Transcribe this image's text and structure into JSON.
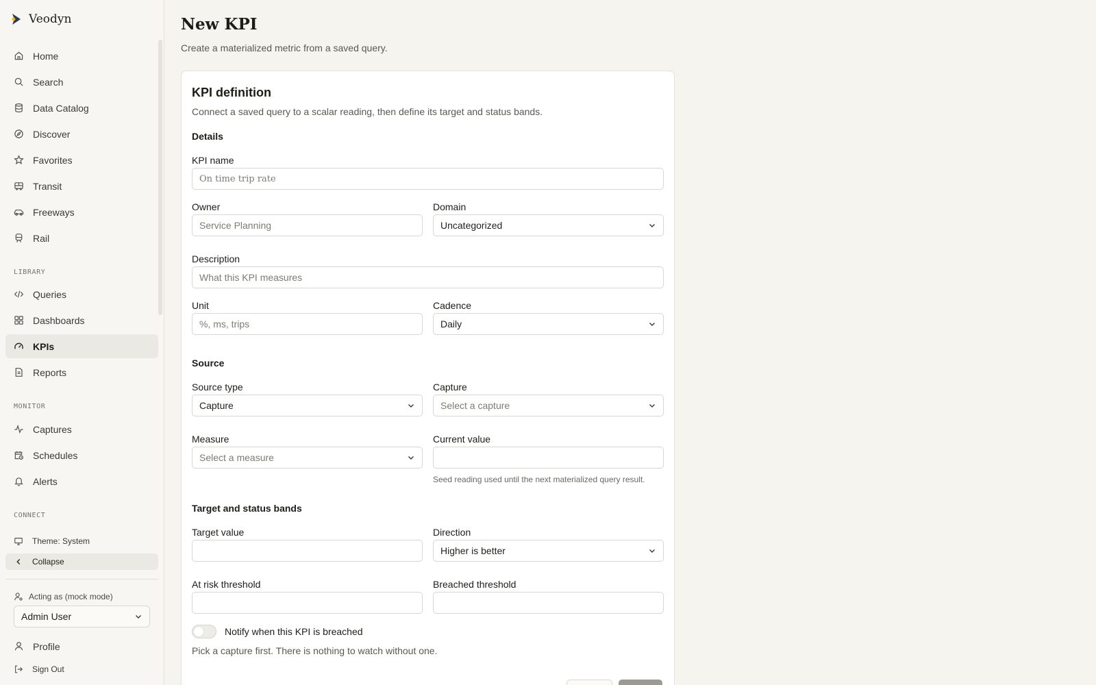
{
  "app": {
    "name": "Veodyn"
  },
  "sidebar": {
    "nav": [
      {
        "label": "Home",
        "icon": "home-icon"
      },
      {
        "label": "Search",
        "icon": "search-icon"
      },
      {
        "label": "Data Catalog",
        "icon": "database-icon"
      },
      {
        "label": "Discover",
        "icon": "compass-icon"
      },
      {
        "label": "Favorites",
        "icon": "star-icon"
      },
      {
        "label": "Transit",
        "icon": "bus-icon"
      },
      {
        "label": "Freeways",
        "icon": "car-icon"
      },
      {
        "label": "Rail",
        "icon": "train-icon"
      }
    ],
    "library_label": "LIBRARY",
    "library": [
      {
        "label": "Queries",
        "icon": "code-icon"
      },
      {
        "label": "Dashboards",
        "icon": "dashboard-icon"
      },
      {
        "label": "KPIs",
        "icon": "gauge-icon",
        "active": true
      },
      {
        "label": "Reports",
        "icon": "report-icon"
      }
    ],
    "monitor_label": "MONITOR",
    "monitor": [
      {
        "label": "Captures",
        "icon": "activity-icon"
      },
      {
        "label": "Schedules",
        "icon": "calendar-clock-icon"
      },
      {
        "label": "Alerts",
        "icon": "bell-icon"
      }
    ],
    "connect_label": "CONNECT",
    "theme_label": "Theme: System",
    "collapse_label": "Collapse",
    "acting_label": "Acting as (mock mode)",
    "acting_user": "Admin User",
    "profile_label": "Profile",
    "signout_label": "Sign Out"
  },
  "page": {
    "title": "New KPI",
    "subtitle": "Create a materialized metric from a saved query."
  },
  "card": {
    "title": "KPI definition",
    "subtitle": "Connect a saved query to a scalar reading, then define its target and status bands.",
    "details_title": "Details",
    "kpi_name": {
      "label": "KPI name",
      "placeholder": "On time trip rate"
    },
    "owner": {
      "label": "Owner",
      "placeholder": "Service Planning"
    },
    "domain": {
      "label": "Domain",
      "value": "Uncategorized"
    },
    "description": {
      "label": "Description",
      "placeholder": "What this KPI measures"
    },
    "unit": {
      "label": "Unit",
      "placeholder": "%, ms, trips"
    },
    "cadence": {
      "label": "Cadence",
      "value": "Daily"
    },
    "source_title": "Source",
    "source_type": {
      "label": "Source type",
      "value": "Capture"
    },
    "capture": {
      "label": "Capture",
      "placeholder": "Select a capture"
    },
    "measure": {
      "label": "Measure",
      "placeholder": "Select a measure"
    },
    "current_value": {
      "label": "Current value",
      "value": "",
      "help": "Seed reading used until the next materialized query result."
    },
    "bands_title": "Target and status bands",
    "target_value": {
      "label": "Target value",
      "value": ""
    },
    "direction": {
      "label": "Direction",
      "value": "Higher is better"
    },
    "at_risk": {
      "label": "At risk threshold",
      "value": ""
    },
    "breached": {
      "label": "Breached threshold",
      "value": ""
    },
    "notify_label": "Notify when this KPI is breached",
    "notify_on": false,
    "note": "Pick a capture first. There is nothing to watch without one."
  },
  "colors": {
    "background": "#f5f4ef",
    "card": "#ffffff",
    "accent": "#f0b323",
    "logo": "#2a3a4a"
  }
}
